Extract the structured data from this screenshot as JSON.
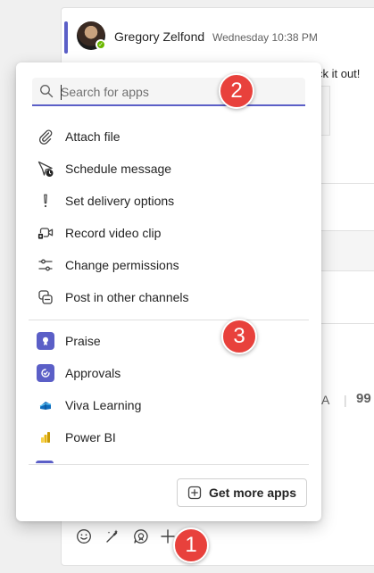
{
  "post": {
    "author": "Gregory Zelfond",
    "timestamp": "Wednesday 10:38 PM",
    "message_fragment": "ck it out!",
    "presence_glyph": "✓",
    "format_text_label": "A",
    "quote_glyph": "99"
  },
  "search": {
    "placeholder": "Search for apps",
    "value": ""
  },
  "actions": [
    {
      "label": "Attach file",
      "icon": "paperclip-icon"
    },
    {
      "label": "Schedule message",
      "icon": "schedule-send-icon"
    },
    {
      "label": "Set delivery options",
      "icon": "exclamation-icon"
    },
    {
      "label": "Record video clip",
      "icon": "video-clip-icon"
    },
    {
      "label": "Change permissions",
      "icon": "sliders-icon"
    },
    {
      "label": "Post in other channels",
      "icon": "post-channels-icon"
    }
  ],
  "apps": [
    {
      "label": "Praise",
      "icon": "praise-app-icon",
      "color": "#5b5fc7"
    },
    {
      "label": "Approvals",
      "icon": "approvals-app-icon",
      "color": "#5b5fc7"
    },
    {
      "label": "Viva Learning",
      "icon": "viva-learning-app-icon",
      "color": "#0f6cbd"
    },
    {
      "label": "Power BI",
      "icon": "power-bi-app-icon",
      "color": "#f2c811"
    }
  ],
  "get_more_apps": "Get more apps",
  "callouts": [
    "2",
    "3",
    "1"
  ],
  "colors": {
    "accent": "#5b5fc7",
    "callout": "#e8413c",
    "presence": "#6bb700"
  }
}
